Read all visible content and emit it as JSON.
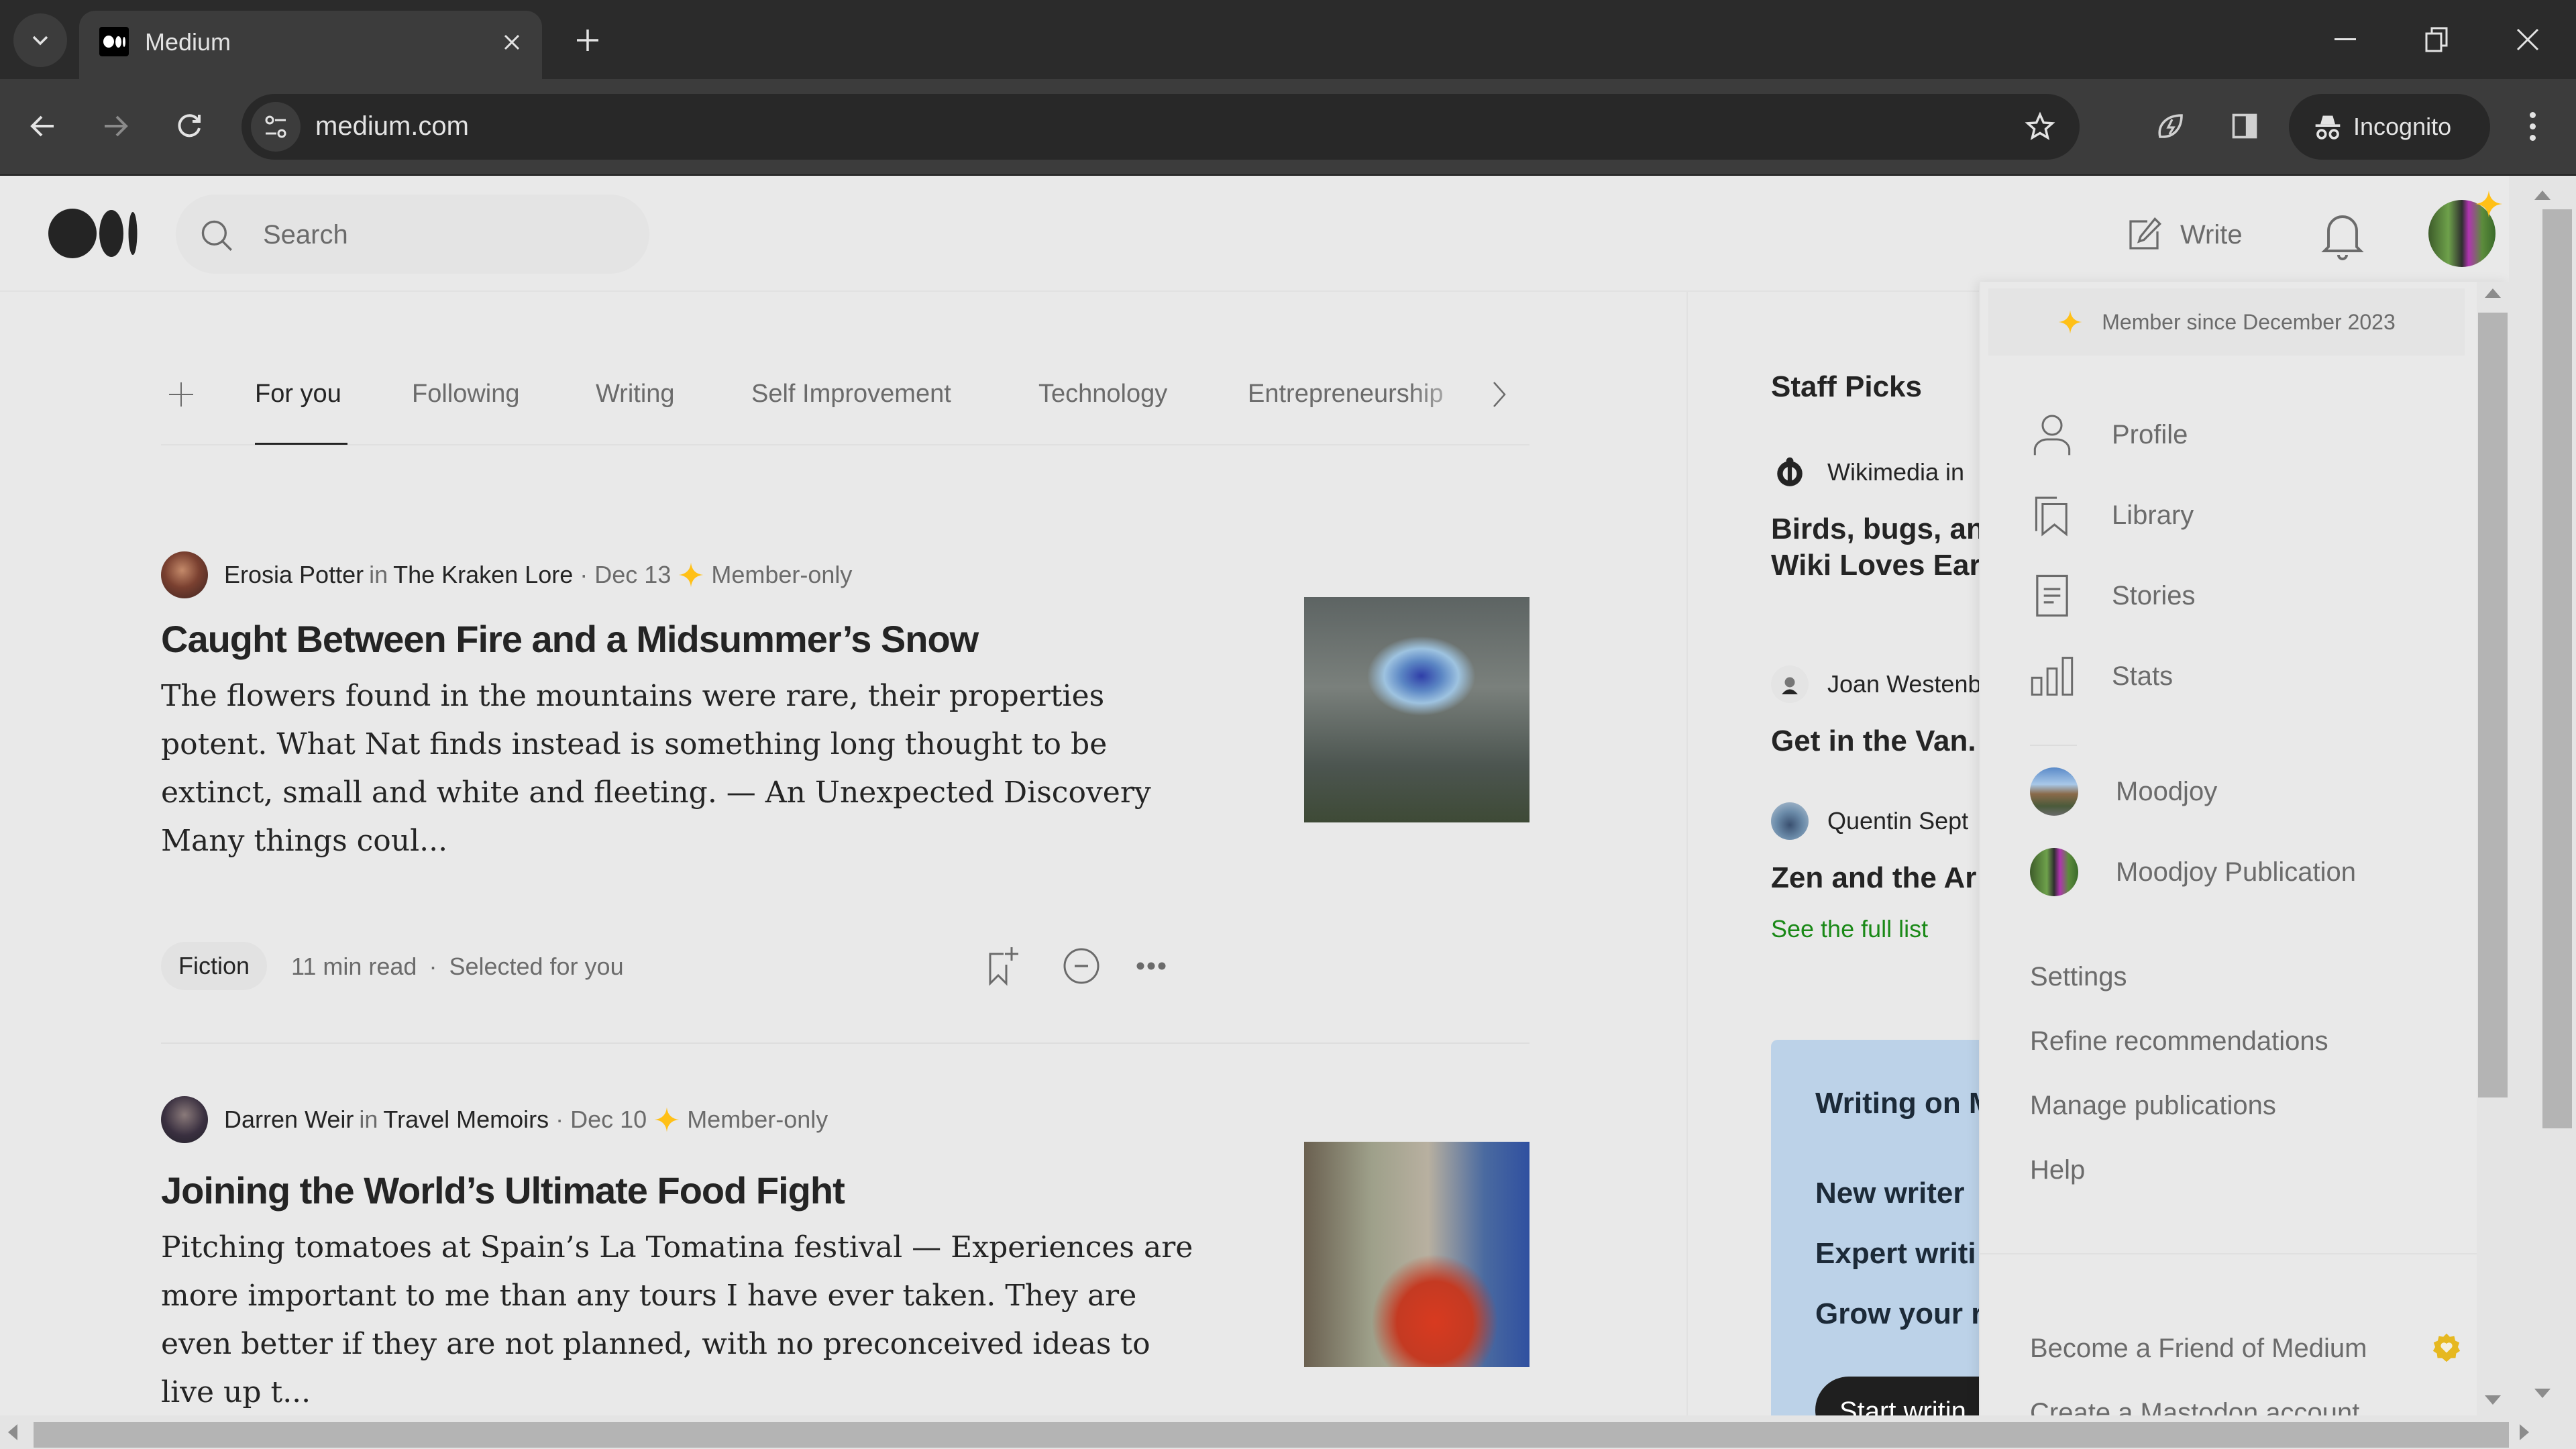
{
  "browser": {
    "tab_title": "Medium",
    "url": "medium.com",
    "incognito_label": "Incognito"
  },
  "header": {
    "search_placeholder": "Search",
    "write_label": "Write"
  },
  "topics": [
    {
      "label": "For you",
      "active": true
    },
    {
      "label": "Following"
    },
    {
      "label": "Writing"
    },
    {
      "label": "Self Improvement"
    },
    {
      "label": "Technology"
    },
    {
      "label": "Entrepreneurship"
    }
  ],
  "articles": [
    {
      "author": "Erosia Potter",
      "in": "in",
      "publication": "The Kraken Lore",
      "date": "· Dec 13",
      "badge": "Member-only",
      "title": "Caught Between Fire and a Midsummer’s Snow",
      "excerpt": "The flowers found in the mountains were rare, their properties potent. What Nat finds instead is something long thought to be extinct, small and white and fleeting. — An Unexpected Discovery Many things coul...",
      "tag": "Fiction",
      "read_time": "11 min read",
      "reason": "Selected for you"
    },
    {
      "author": "Darren Weir",
      "in": "in",
      "publication": "Travel Memoirs",
      "date": "· Dec 10",
      "badge": "Member-only",
      "title": "Joining the World’s Ultimate Food Fight",
      "excerpt": "Pitching tomatoes at Spain’s La Tomatina festival — Experiences are more important to me than any tours I have ever taken. They are even better if they are not planned, with no preconceived ideas to live up t..."
    }
  ],
  "staff_picks": {
    "title": "Staff Picks",
    "items": [
      {
        "author": "Wikimedia in",
        "title_line1": "Birds, bugs, an",
        "title_line2": "Wiki Loves Ear"
      },
      {
        "author": "Joan Westenb",
        "title_line1": "Get in the Van."
      },
      {
        "author": "Quentin Sept",
        "title_line1": "Zen and the Ar"
      }
    ],
    "see_full_list": "See the full list",
    "writing_card": {
      "title": "Writing on M",
      "lines": [
        "New writer",
        "Expert writi",
        "Grow your r"
      ],
      "button": "Start writin"
    }
  },
  "dropdown": {
    "member_since": "Member since December 2023",
    "primary_items": [
      {
        "label": "Profile",
        "icon": "person-icon"
      },
      {
        "label": "Library",
        "icon": "library-icon"
      },
      {
        "label": "Stories",
        "icon": "stories-icon"
      },
      {
        "label": "Stats",
        "icon": "stats-icon"
      }
    ],
    "accounts": [
      {
        "label": "Moodjoy"
      },
      {
        "label": "Moodjoy Publication"
      }
    ],
    "secondary_items": [
      "Settings",
      "Refine recommendations",
      "Manage publications",
      "Help"
    ],
    "footer_items": [
      "Become a Friend of Medium",
      "Create a Mastodon account"
    ]
  },
  "colors": {
    "accent_green": "#1a8917",
    "member_star": "#ffc017",
    "writing_card_bg": "#bcd2e8"
  }
}
